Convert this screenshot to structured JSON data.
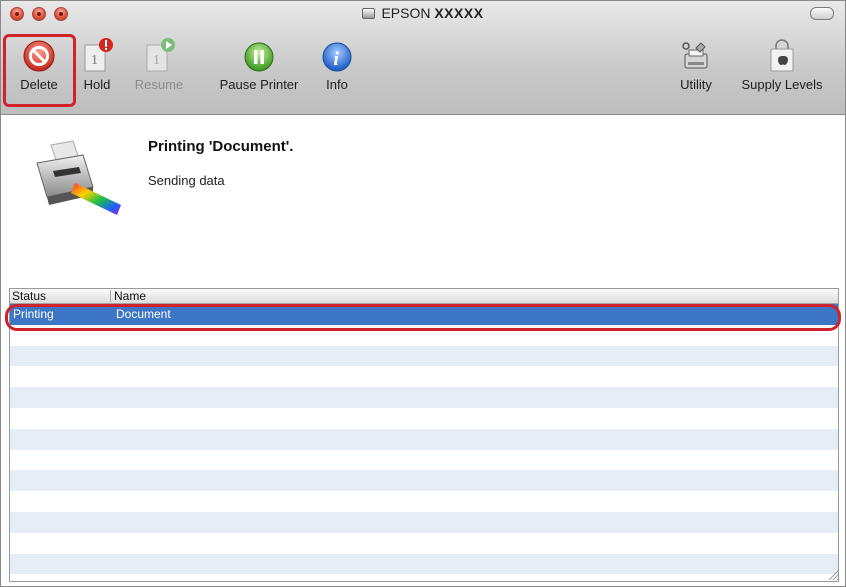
{
  "window": {
    "title_prefix": "EPSON",
    "title_model": "XXXXX"
  },
  "toolbar": {
    "delete_label": "Delete",
    "hold_label": "Hold",
    "resume_label": "Resume",
    "pause_printer_label": "Pause Printer",
    "info_label": "Info",
    "utility_label": "Utility",
    "supply_levels_label": "Supply Levels"
  },
  "status": {
    "title": "Printing 'Document'.",
    "detail": "Sending data"
  },
  "jobs": {
    "columns": [
      "Status",
      "Name"
    ],
    "rows": [
      {
        "status": "Printing",
        "name": "Document",
        "selected": true
      }
    ]
  },
  "colors": {
    "highlight": "#d0222a",
    "selection": "#3d76c5",
    "stripe": "#e6edf6"
  }
}
